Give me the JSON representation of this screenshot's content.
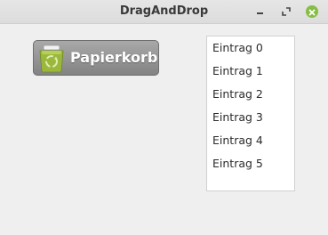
{
  "window": {
    "title": "DragAndDrop",
    "controls": {
      "minimize": "minimize-icon",
      "maximize": "maximize-icon",
      "close": "close-icon"
    }
  },
  "trash": {
    "label": "Papierkorb",
    "icon": "recycle-bin-icon"
  },
  "list": {
    "items": [
      {
        "label": "Eintrag 0"
      },
      {
        "label": "Eintrag 1"
      },
      {
        "label": "Eintrag 2"
      },
      {
        "label": "Eintrag 3"
      },
      {
        "label": "Eintrag 4"
      },
      {
        "label": "Eintrag 5"
      }
    ]
  },
  "colors": {
    "close_button": "#86be43",
    "trash_background": "#969696",
    "list_background": "#ffffff"
  }
}
